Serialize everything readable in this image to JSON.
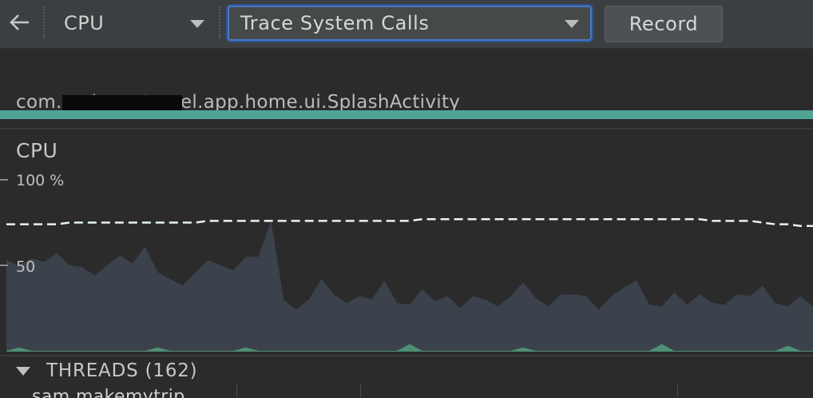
{
  "toolbar": {
    "back_icon": "back-arrow-icon",
    "profiler_label": "CPU",
    "config_label": "Trace System Calls",
    "record_label": "Record",
    "caret_icon": "chevron-down-icon"
  },
  "activity": {
    "label": "com.makemytravel.app.home.ui.SplashActivity",
    "bar_color": "#4fa496"
  },
  "cpu": {
    "title": "CPU",
    "axis_top_label": "100 %",
    "axis_mid_label": "50"
  },
  "threads": {
    "title": "THREADS (162)",
    "first_thread": "sam.makemytrip"
  },
  "chart_data": {
    "type": "area",
    "ylim": [
      0,
      100
    ],
    "x": [
      0,
      1,
      2,
      3,
      4,
      5,
      6,
      7,
      8,
      9,
      10,
      11,
      12,
      13,
      14,
      15,
      16,
      17,
      18,
      19,
      20,
      21,
      22,
      23,
      24,
      25,
      26,
      27,
      28,
      29,
      30,
      31,
      32,
      33,
      34,
      35,
      36,
      37,
      38,
      39,
      40,
      41,
      42,
      43,
      44,
      45,
      46,
      47,
      48,
      49,
      50,
      51,
      52,
      53,
      54,
      55,
      56,
      57,
      58,
      59,
      60,
      61,
      62,
      63,
      64
    ],
    "series": [
      {
        "values": [
          53,
          50,
          54,
          52,
          57,
          50,
          49,
          44,
          50,
          56,
          51,
          61,
          46,
          42,
          38,
          46,
          53,
          50,
          47,
          55,
          55,
          76,
          30,
          24,
          30,
          42,
          33,
          28,
          32,
          30,
          41,
          28,
          27,
          36,
          29,
          32,
          25,
          32,
          30,
          26,
          32,
          40,
          31,
          26,
          33,
          33,
          32,
          24,
          32,
          37,
          41,
          27,
          26,
          34,
          27,
          33,
          28,
          27,
          33,
          32,
          38,
          28,
          26,
          32,
          26
        ],
        "color": "#3b424c"
      },
      {
        "values": [
          0,
          2,
          0,
          0,
          0,
          0,
          0,
          0,
          0,
          0,
          0,
          0,
          2,
          0,
          0,
          0,
          0,
          0,
          0,
          2,
          0,
          0,
          0,
          0,
          0,
          0,
          0,
          0,
          0,
          0,
          0,
          0,
          4,
          0,
          0,
          0,
          0,
          0,
          0,
          0,
          0,
          2,
          0,
          0,
          0,
          0,
          0,
          0,
          0,
          0,
          0,
          0,
          4,
          0,
          0,
          0,
          0,
          0,
          0,
          0,
          0,
          0,
          3,
          0,
          0
        ],
        "color": "#4e8f73"
      },
      {
        "values": [
          74,
          74,
          74,
          74,
          74,
          75,
          75,
          75,
          75,
          75,
          75,
          75,
          75,
          75,
          75,
          75,
          76,
          76,
          76,
          76,
          76,
          76,
          76,
          76,
          76,
          76,
          76,
          76,
          76,
          76,
          76,
          76,
          76,
          77,
          77,
          77,
          77,
          77,
          77,
          77,
          77,
          77,
          77,
          77,
          77,
          77,
          77,
          77,
          77,
          77,
          77,
          77,
          77,
          77,
          77,
          77,
          76,
          76,
          76,
          76,
          75,
          74,
          74,
          73,
          73
        ],
        "color": "#e8f4f0",
        "dashed": true
      }
    ]
  }
}
